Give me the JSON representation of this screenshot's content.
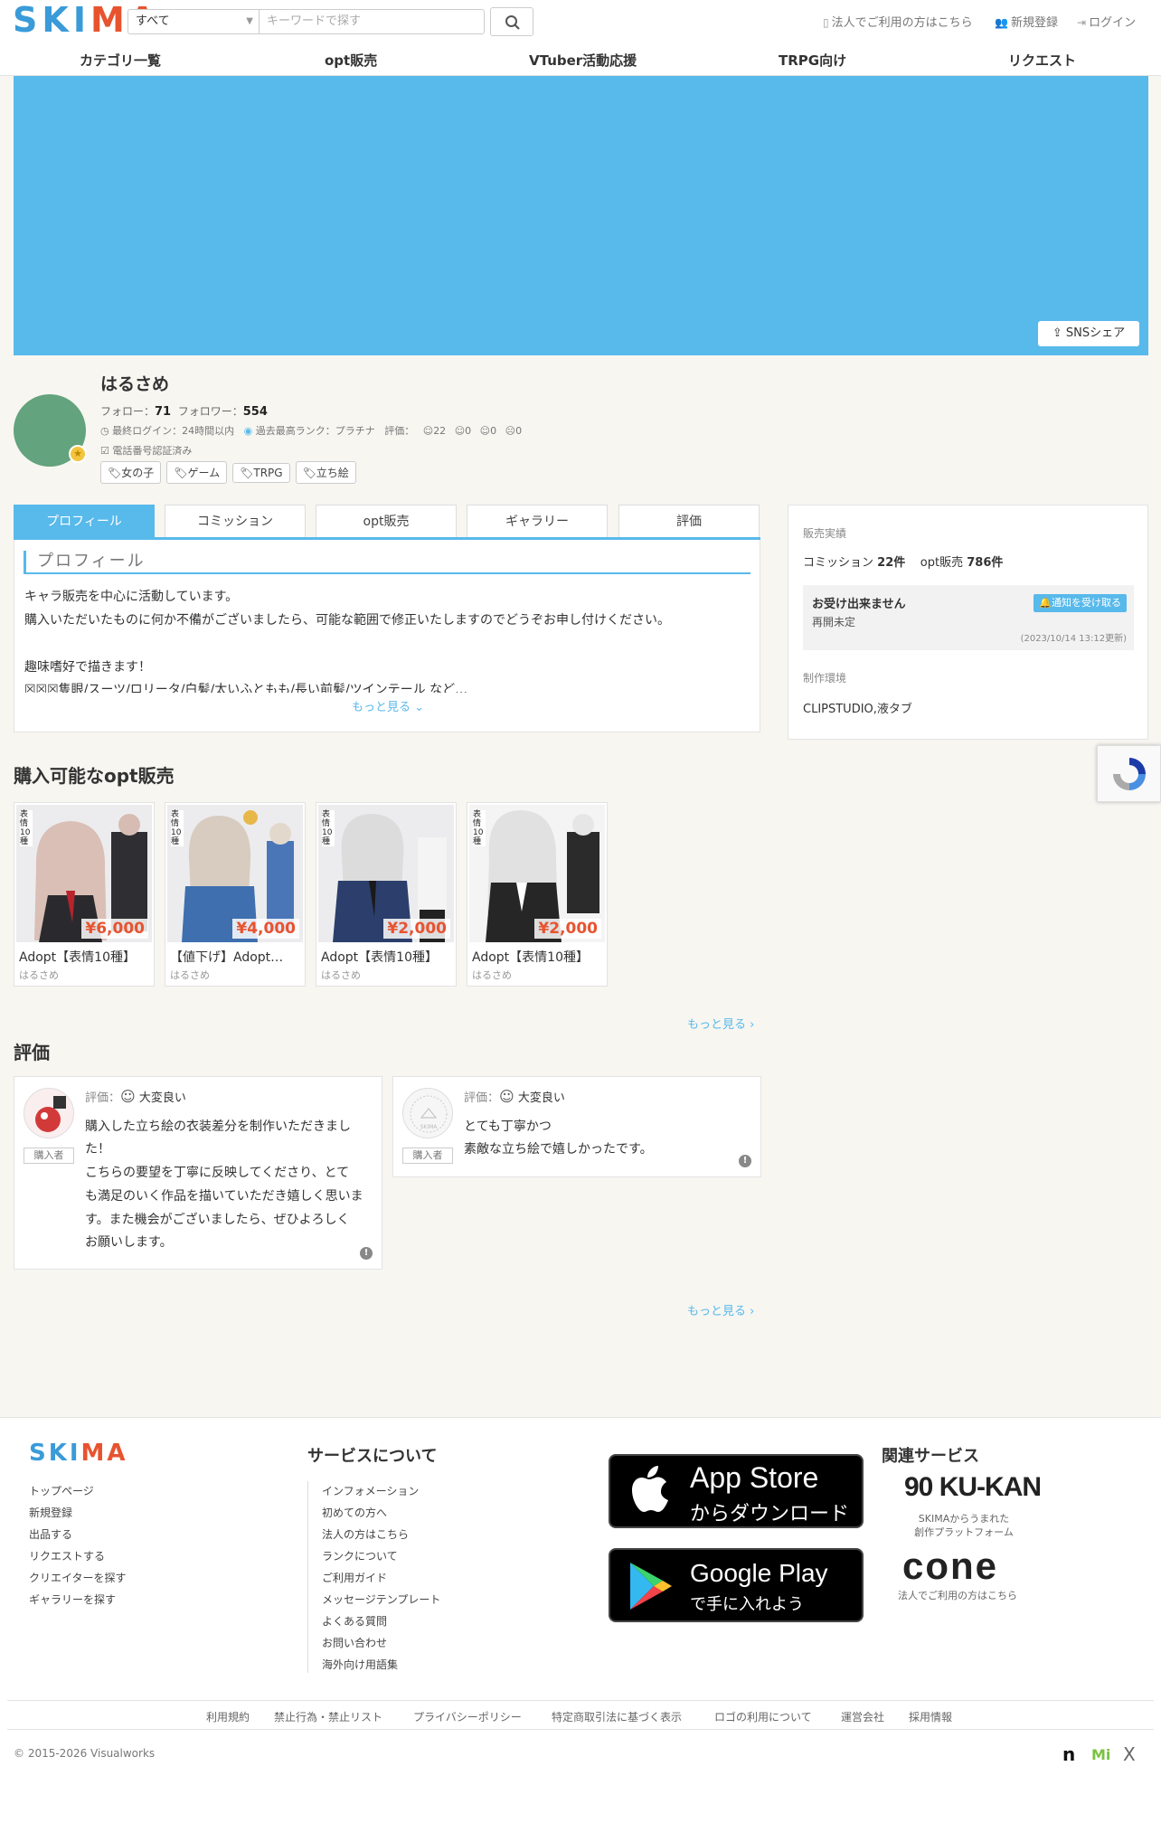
{
  "header": {
    "logo": "SKIMA",
    "category_select": "すべて",
    "search_placeholder": "キーワードで探す",
    "corporate_link": "法人でご利用の方はこちら",
    "register_link": "新規登録",
    "login_link": "ログイン",
    "nav": [
      "カテゴリ一覧",
      "opt販売",
      "VTuber活動応援",
      "TRPG向け",
      "リクエスト"
    ]
  },
  "banner": {
    "color": "#58b9eb",
    "share_button": "SNSシェア"
  },
  "profile": {
    "name": "はるさめ",
    "follow_label": "フォロー：",
    "follow_count": "71",
    "follower_label": "フォロワー：",
    "follower_count": "554",
    "last_login": "最終ログイン：24時間以内",
    "best_rank": "過去最高ランク：プラチナ",
    "rating_label": "評価：",
    "ratings": [
      "22",
      "0",
      "0",
      "0"
    ],
    "phone_verified": "電話番号認証済み",
    "tags": [
      "女の子",
      "ゲーム",
      "TRPG",
      "立ち絵"
    ]
  },
  "tabs": [
    "プロフィール",
    "コミッション",
    "opt販売",
    "ギャラリー",
    "評価"
  ],
  "profile_section": {
    "title": "プロフィール",
    "lines": [
      "キャラ販売を中心に活動しています。",
      "購入いただいたものに何か不備がございましたら、可能な範囲で修正いたしますのでどうぞお申し付けください。",
      "趣味嗜好で描きます！",
      "☒☒☒隻眼/スーツ/ロリータ/白髪/太いふともも/長い前髪/ツインテール など…"
    ],
    "more": "もっと見る"
  },
  "sidebar": {
    "sales_label": "販売実績",
    "commission_label": "コミッション",
    "commission_count": "22件",
    "opt_label": "opt販売",
    "opt_count": "786件",
    "status_title": "お受け出来ません",
    "status_sub": "再開未定",
    "notify_button": "通知を受け取る",
    "updated": "(2023/10/14 13:12更新)",
    "env_label": "制作環境",
    "env_value": "CLIPSTUDIO,液タブ"
  },
  "opt_section": {
    "title": "購入可能なopt販売",
    "more": "もっと見る",
    "items": [
      {
        "price": "¥6,000",
        "title": "Adopt【表情10種】",
        "author": "はるさめ"
      },
      {
        "price": "¥4,000",
        "title": "【値下げ】Adopt…",
        "author": "はるさめ"
      },
      {
        "price": "¥2,000",
        "title": "Adopt【表情10種】",
        "author": "はるさめ"
      },
      {
        "price": "¥2,000",
        "title": "Adopt【表情10種】",
        "author": "はるさめ"
      }
    ],
    "card_tag": "表情10種"
  },
  "review_section": {
    "title": "評価",
    "more": "もっと見る",
    "reviews": [
      {
        "score_label": "評価：",
        "score": "大変良い",
        "badge": "購入者",
        "lines": [
          "購入した立ち絵の衣装差分を制作いただきまし",
          "た！",
          "こちらの要望を丁寧に反映してくださり、とて",
          "も満足のいく作品を描いていただき嬉しく思いま",
          "す。また機会がございましたら、ぜひよろしく",
          "お願いします。"
        ]
      },
      {
        "score_label": "評価：",
        "score": "大変良い",
        "badge": "購入者",
        "lines": [
          "とても丁寧かつ",
          "素敵な立ち絵で嬉しかったです。"
        ]
      }
    ]
  },
  "footer": {
    "logo": "SKIMA",
    "left_links": [
      "トップページ",
      "新規登録",
      "出品する",
      "リクエストする",
      "クリエイターを探す",
      "ギャラリーを探す"
    ],
    "service_title": "サービスについて",
    "service_links": [
      "インフォメーション",
      "初めての方へ",
      "法人の方はこちら",
      "ランクについて",
      "ご利用ガイド",
      "メッセージテンプレート",
      "よくある質問",
      "お問い合わせ",
      "海外向け用語集"
    ],
    "app_store_big": "App Store",
    "app_store_small": "からダウンロード",
    "google_big": "Google Play",
    "google_small": "で手に入れよう",
    "related_title": "関連サービス",
    "kukan": "90 KU-KAN",
    "kukan_sub1": "SKIMAからうまれた",
    "kukan_sub2": "創作プラットフォーム",
    "cone": "cone",
    "cone_sub": "法人でご利用の方はこちら",
    "bottom_links": [
      "利用規約",
      "禁止行為・禁止リスト",
      "プライバシーポリシー",
      "特定商取引法に基づく表示",
      "ロゴの利用について",
      "運営会社",
      "採用情報"
    ],
    "copyright": "© 2015-2026 Visualworks",
    "social": [
      "n",
      "Mi",
      "X"
    ]
  },
  "colors": {
    "accent": "#58b9eb",
    "logo_blue": "#3a9bd8",
    "logo_red": "#e8532f",
    "price": "#e8532f"
  }
}
